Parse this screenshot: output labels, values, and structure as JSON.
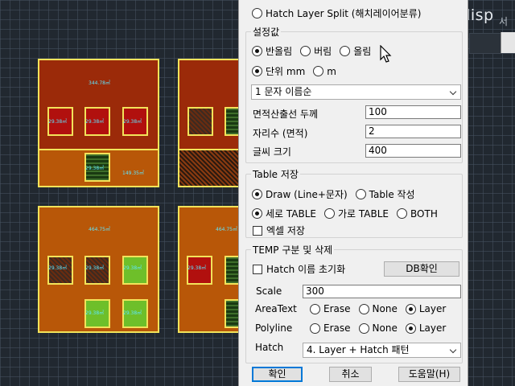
{
  "background": {
    "watermark": "LEE_lisp",
    "watermark_side": "서",
    "buildings": [
      {
        "name": "building-top-left",
        "area": "344.78㎡",
        "annex_label": "149.35㎡",
        "rooms": [
          "29.38㎡",
          "29.38㎡",
          "29.38㎡",
          "29.38㎡"
        ]
      },
      {
        "name": "building-bottom-left",
        "area": "464.75㎡",
        "rooms": [
          "29.38㎡",
          "29.38㎡",
          "29.38㎡",
          "29.38㎡",
          "29.38㎡"
        ]
      },
      {
        "name": "building-bottom-right",
        "area": "464.75㎡",
        "rooms": [
          "29.38㎡"
        ]
      }
    ]
  },
  "dialog": {
    "hatch_split_label": "Hatch Layer Split (해치레이어분류)",
    "settings_group": "설정값",
    "rounding": {
      "options": [
        "반올림",
        "버림",
        "올림"
      ],
      "selected": 0
    },
    "unit": {
      "options": [
        "단위 mm",
        "m"
      ],
      "selected": 0
    },
    "sort_select": "1 문자 이름순",
    "fields": [
      {
        "label": "면적산출선 두께",
        "value": "100"
      },
      {
        "label": "자리수 (면적)",
        "value": "2"
      },
      {
        "label": "글씨 크기",
        "value": "400"
      }
    ],
    "table_group": "Table 저장",
    "draw_mode": {
      "options": [
        "Draw (Line+문자)",
        "Table 작성"
      ],
      "selected": 0
    },
    "table_direction": {
      "options": [
        "세로 TABLE",
        "가로 TABLE",
        "BOTH"
      ],
      "selected": 0
    },
    "excel_save_label": "엑셀 저장",
    "temp_group": "TEMP 구분 및 삭제",
    "hatch_reset_label": "Hatch 이름 초기화",
    "db_check_button": "DB확인",
    "scale_label": "Scale",
    "scale_value": "300",
    "areatext": {
      "label": "AreaText",
      "options": [
        "Erase",
        "None",
        "Layer"
      ],
      "selected": 2
    },
    "polyline": {
      "label": "Polyline",
      "options": [
        "Erase",
        "None",
        "Layer"
      ],
      "selected": 2
    },
    "hatch_label": "Hatch",
    "hatch_select": "4. Layer + Hatch 패턴",
    "buttons": {
      "ok": "확인",
      "cancel": "취소",
      "help": "도움말(H)"
    }
  }
}
